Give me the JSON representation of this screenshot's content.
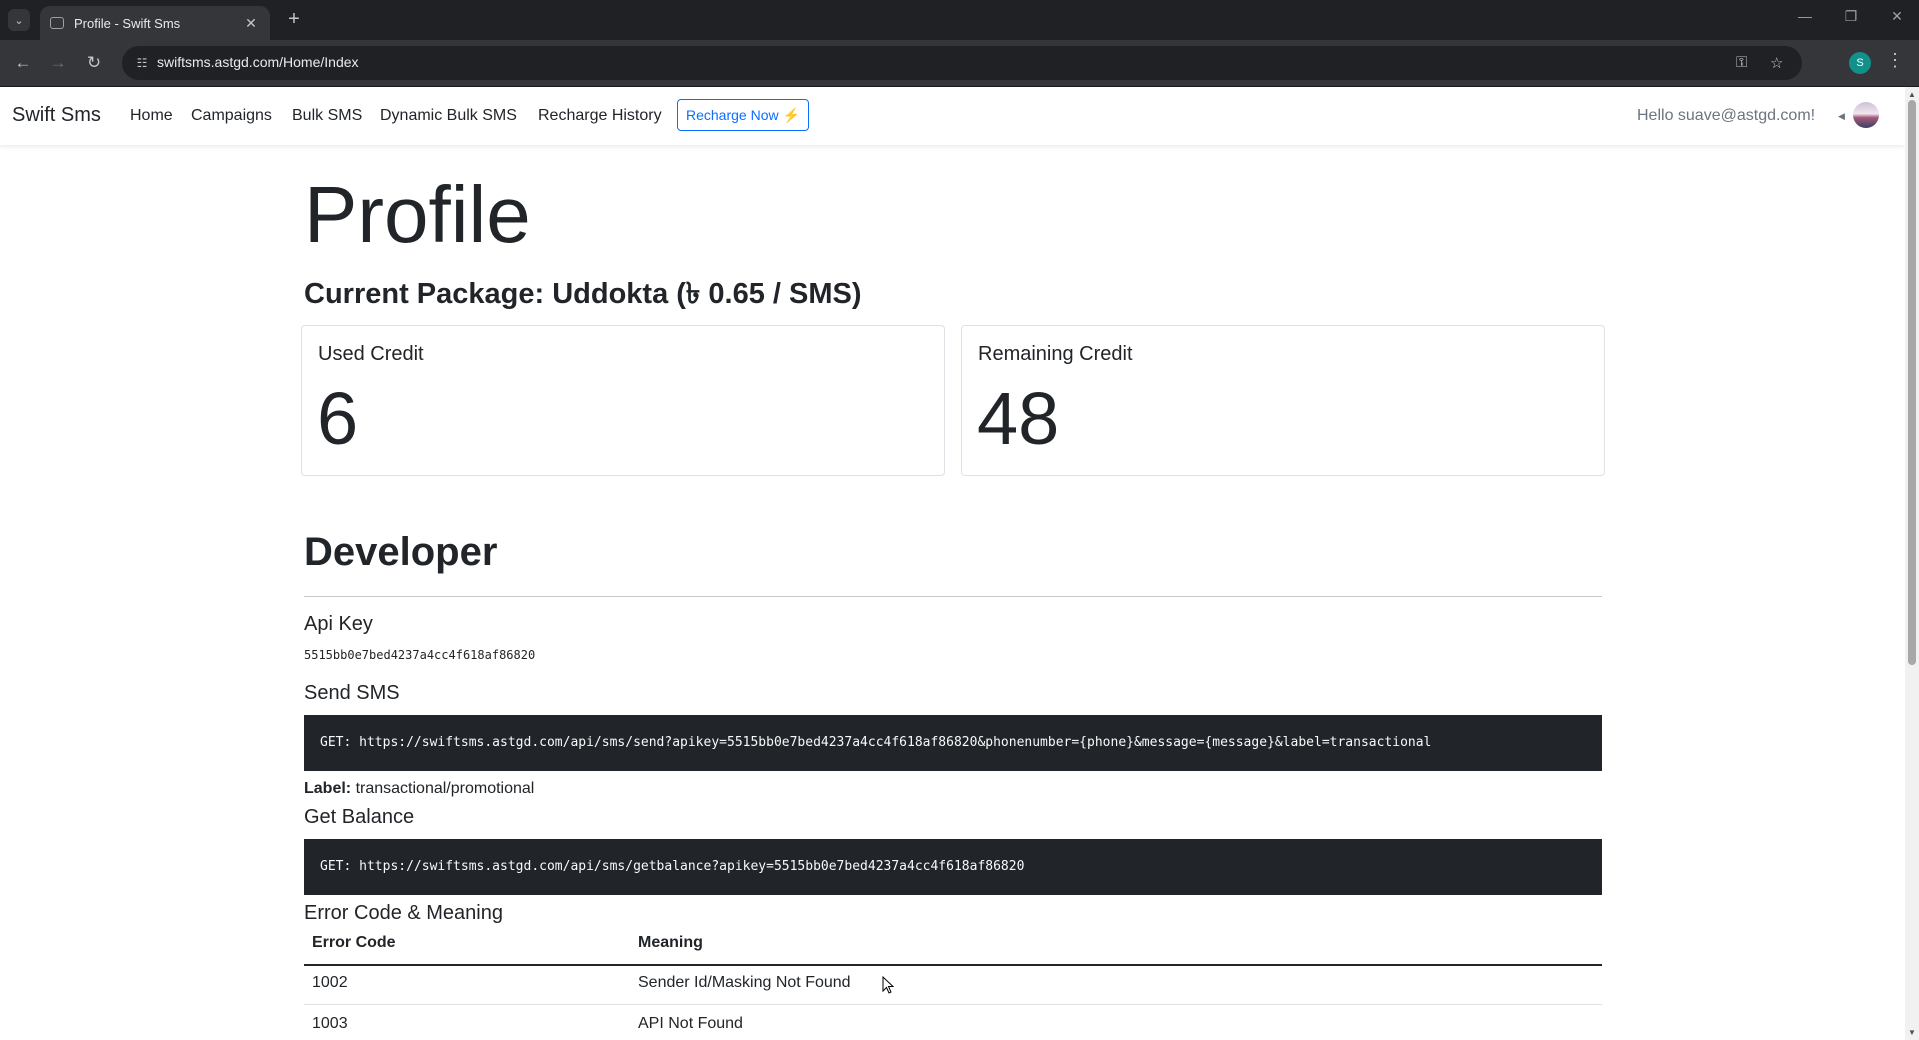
{
  "browser": {
    "tab_title": "Profile - Swift Sms",
    "url": "swiftsms.astgd.com/Home/Index",
    "profile_initial": "S"
  },
  "navbar": {
    "brand": "Swift Sms",
    "links": [
      "Home",
      "Campaigns",
      "Bulk SMS",
      "Dynamic Bulk SMS",
      "Recharge History"
    ],
    "recharge_button": "Recharge Now ⚡",
    "greeting": "Hello suave@astgd.com!"
  },
  "profile": {
    "title": "Profile",
    "package": "Current Package: Uddokta (৳ 0.65 / SMS)",
    "used_credit_label": "Used Credit",
    "used_credit_value": "6",
    "remaining_credit_label": "Remaining Credit",
    "remaining_credit_value": "48"
  },
  "developer": {
    "title": "Developer",
    "api_key_label": "Api Key",
    "api_key": "5515bb0e7bed4237a4cc4f618af86820",
    "send_sms_label": "Send SMS",
    "send_sms_code": "GET: https://swiftsms.astgd.com/api/sms/send?apikey=5515bb0e7bed4237a4cc4f618af86820&phonenumber={phone}&message={message}&label=transactional",
    "label_key": "Label:",
    "label_value": "transactional/promotional",
    "get_balance_label": "Get Balance",
    "get_balance_code": "GET: https://swiftsms.astgd.com/api/sms/getbalance?apikey=5515bb0e7bed4237a4cc4f618af86820",
    "error_title": "Error Code & Meaning",
    "error_table": {
      "headers": [
        "Error Code",
        "Meaning"
      ],
      "rows": [
        [
          "1002",
          "Sender Id/Masking Not Found"
        ],
        [
          "1003",
          "API Not Found"
        ]
      ]
    }
  }
}
